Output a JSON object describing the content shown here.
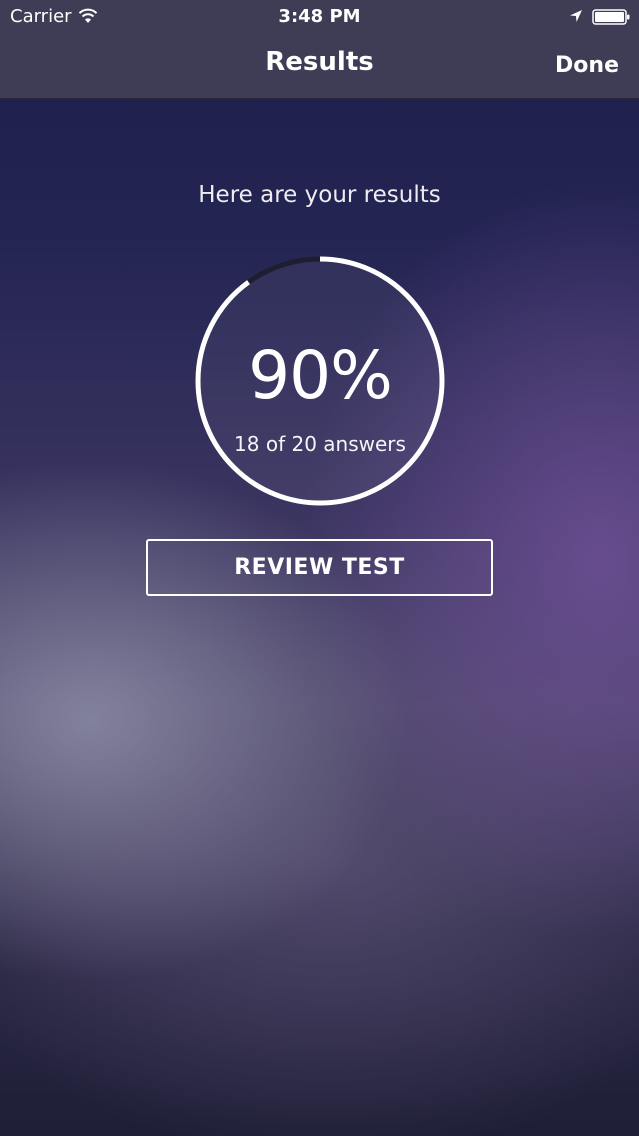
{
  "status_bar": {
    "carrier": "Carrier",
    "time": "3:48 PM",
    "icons": [
      "wifi-icon",
      "location-icon",
      "battery-icon"
    ]
  },
  "nav": {
    "title": "Results",
    "done_label": "Done"
  },
  "results": {
    "heading": "Here are your results",
    "score_percent": "90%",
    "score_fraction": 0.9,
    "correct": 18,
    "total": 20,
    "detail": "18 of 20 answers"
  },
  "actions": {
    "review_label": "REVIEW TEST"
  },
  "colors": {
    "nav_bar": "#3f3d55",
    "ring_fill": "#ffffff",
    "ring_track": "#1e1e30",
    "text": "#ffffff"
  }
}
